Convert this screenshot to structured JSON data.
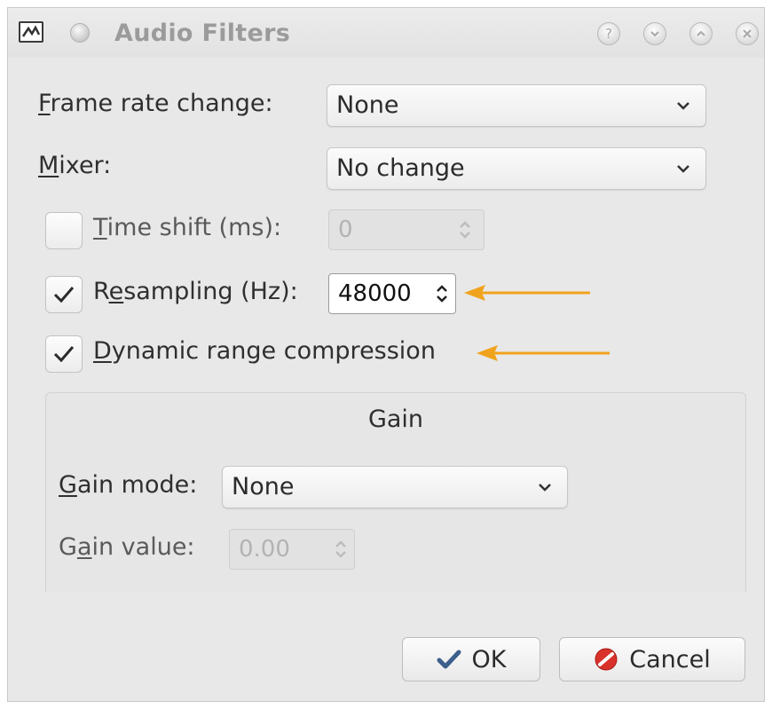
{
  "window": {
    "title": "Audio Filters",
    "titlebar_buttons": [
      "help-icon",
      "minimize-icon",
      "maximize-icon",
      "close-icon"
    ]
  },
  "frame_rate": {
    "label_u": "F",
    "label_rest": "rame rate change:",
    "value": "None"
  },
  "mixer": {
    "label_u": "M",
    "label_rest": "ixer:",
    "value": "No change"
  },
  "time_shift": {
    "checked": false,
    "label_u": "T",
    "label_rest": "ime shift (ms):",
    "value": "0"
  },
  "resampling": {
    "checked": true,
    "label_pre": "R",
    "label_u": "e",
    "label_rest": "sampling (Hz):",
    "value": "48000"
  },
  "drc": {
    "checked": true,
    "label_u": "D",
    "label_rest": "ynamic range compression"
  },
  "gain": {
    "title": "Gain",
    "mode": {
      "label_u": "G",
      "label_rest": "ain mode:",
      "value": "None"
    },
    "value": {
      "label_pre": "G",
      "label_u": "a",
      "label_rest": "in value:",
      "value": "0.00"
    }
  },
  "buttons": {
    "ok": "OK",
    "cancel": "Cancel"
  },
  "colors": {
    "accent_arrow": "#f0a31c",
    "cancel_icon": "#d8322a",
    "ok_icon": "#3d5f8c"
  }
}
